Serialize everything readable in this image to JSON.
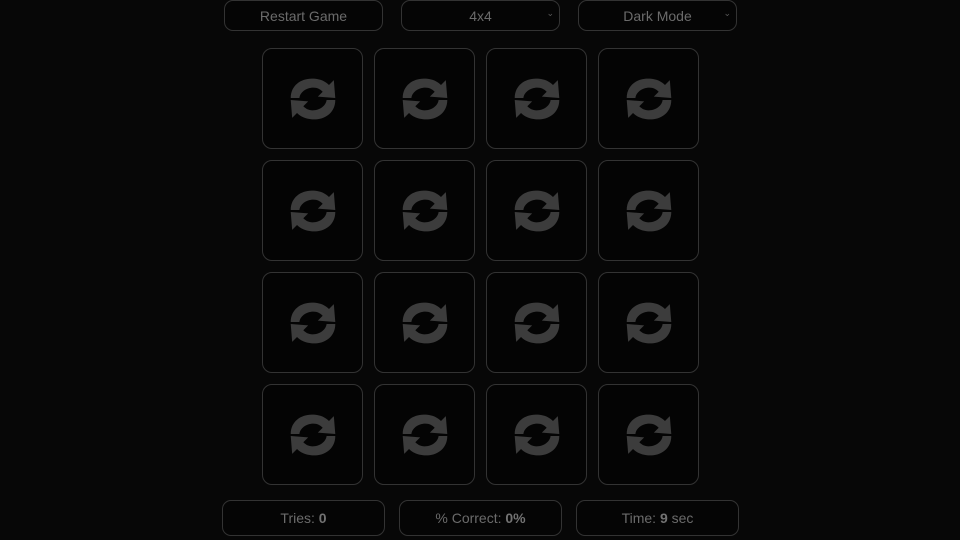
{
  "controls": {
    "restart_label": "Restart Game",
    "size_value": "4x4",
    "theme_value": "Dark Mode"
  },
  "board": {
    "rows": 4,
    "cols": 4,
    "card_back_icon": "swap-arrows-icon",
    "card_icon_color": "#3c3c3c"
  },
  "stats": {
    "tries_label": "Tries: ",
    "tries_value": "0",
    "correct_label": "% Correct: ",
    "correct_value": "0%",
    "time_label": "Time: ",
    "time_value": "9",
    "time_unit": " sec"
  },
  "theme": {
    "background": "#070707",
    "border": "#333333",
    "text": "#6b6b6b"
  }
}
